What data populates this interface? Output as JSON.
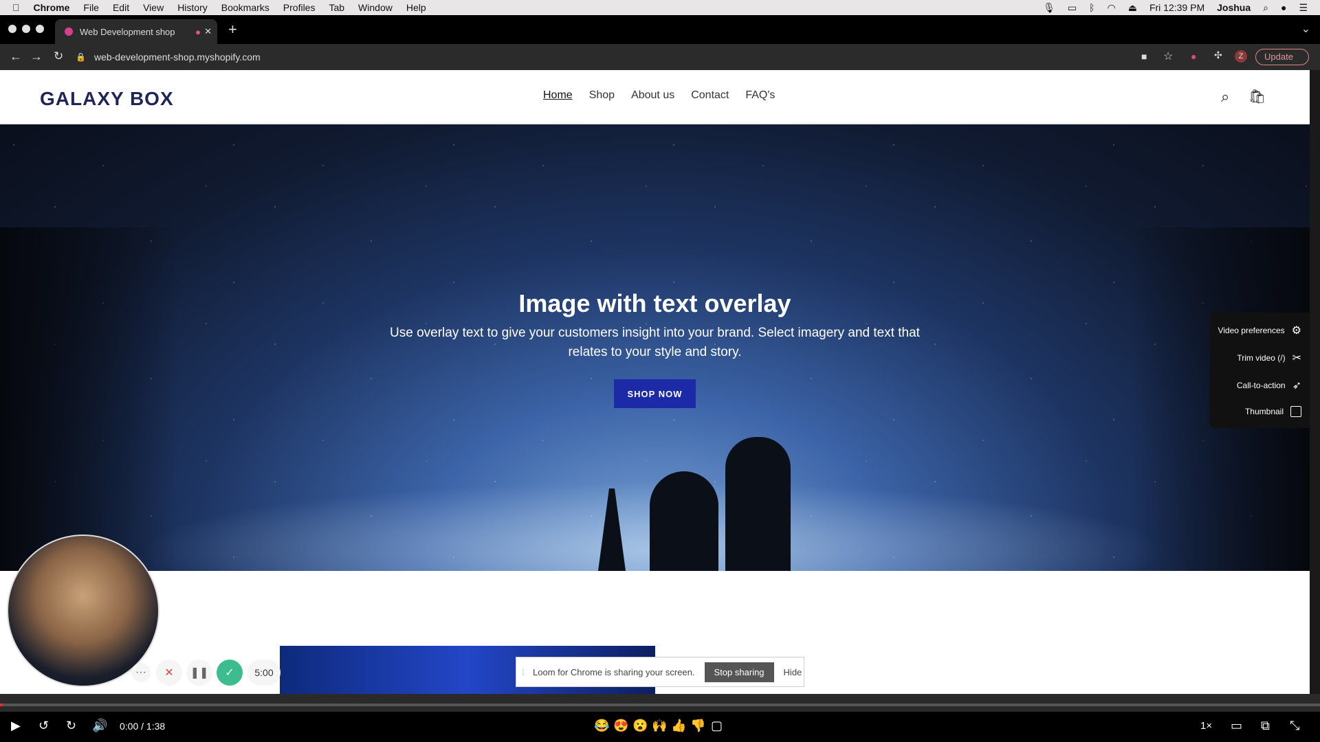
{
  "menubar": {
    "app": "Chrome",
    "items": [
      "File",
      "Edit",
      "View",
      "History",
      "Bookmarks",
      "Profiles",
      "Tab",
      "Window",
      "Help"
    ],
    "clock": "Fri 12:39 PM",
    "user": "Joshua"
  },
  "browser": {
    "tab_title": "Web Development shop",
    "url": "web-development-shop.myshopify.com",
    "update_label": "Update",
    "profile_initial": "Z"
  },
  "site": {
    "logo": "GALAXY BOX",
    "nav": [
      "Home",
      "Shop",
      "About us",
      "Contact",
      "FAQ's"
    ],
    "hero": {
      "title": "Image with text overlay",
      "text": "Use overlay text to give your customers insight into your brand. Select imagery and text that relates to your style and story.",
      "button": "SHOP NOW"
    }
  },
  "loom": {
    "panel": [
      "Video preferences",
      "Trim video (/)",
      "Call-to-action",
      "Thumbnail"
    ],
    "timer": "5:00",
    "share_text": "Loom for Chrome is sharing your screen.",
    "stop_label": "Stop sharing",
    "hide_label": "Hide"
  },
  "player": {
    "time": "0:00 / 1:38",
    "progress": 0.0,
    "speed": "1×",
    "reactions": [
      "😂",
      "😍",
      "😮",
      "🙌",
      "👍",
      "👎"
    ]
  }
}
